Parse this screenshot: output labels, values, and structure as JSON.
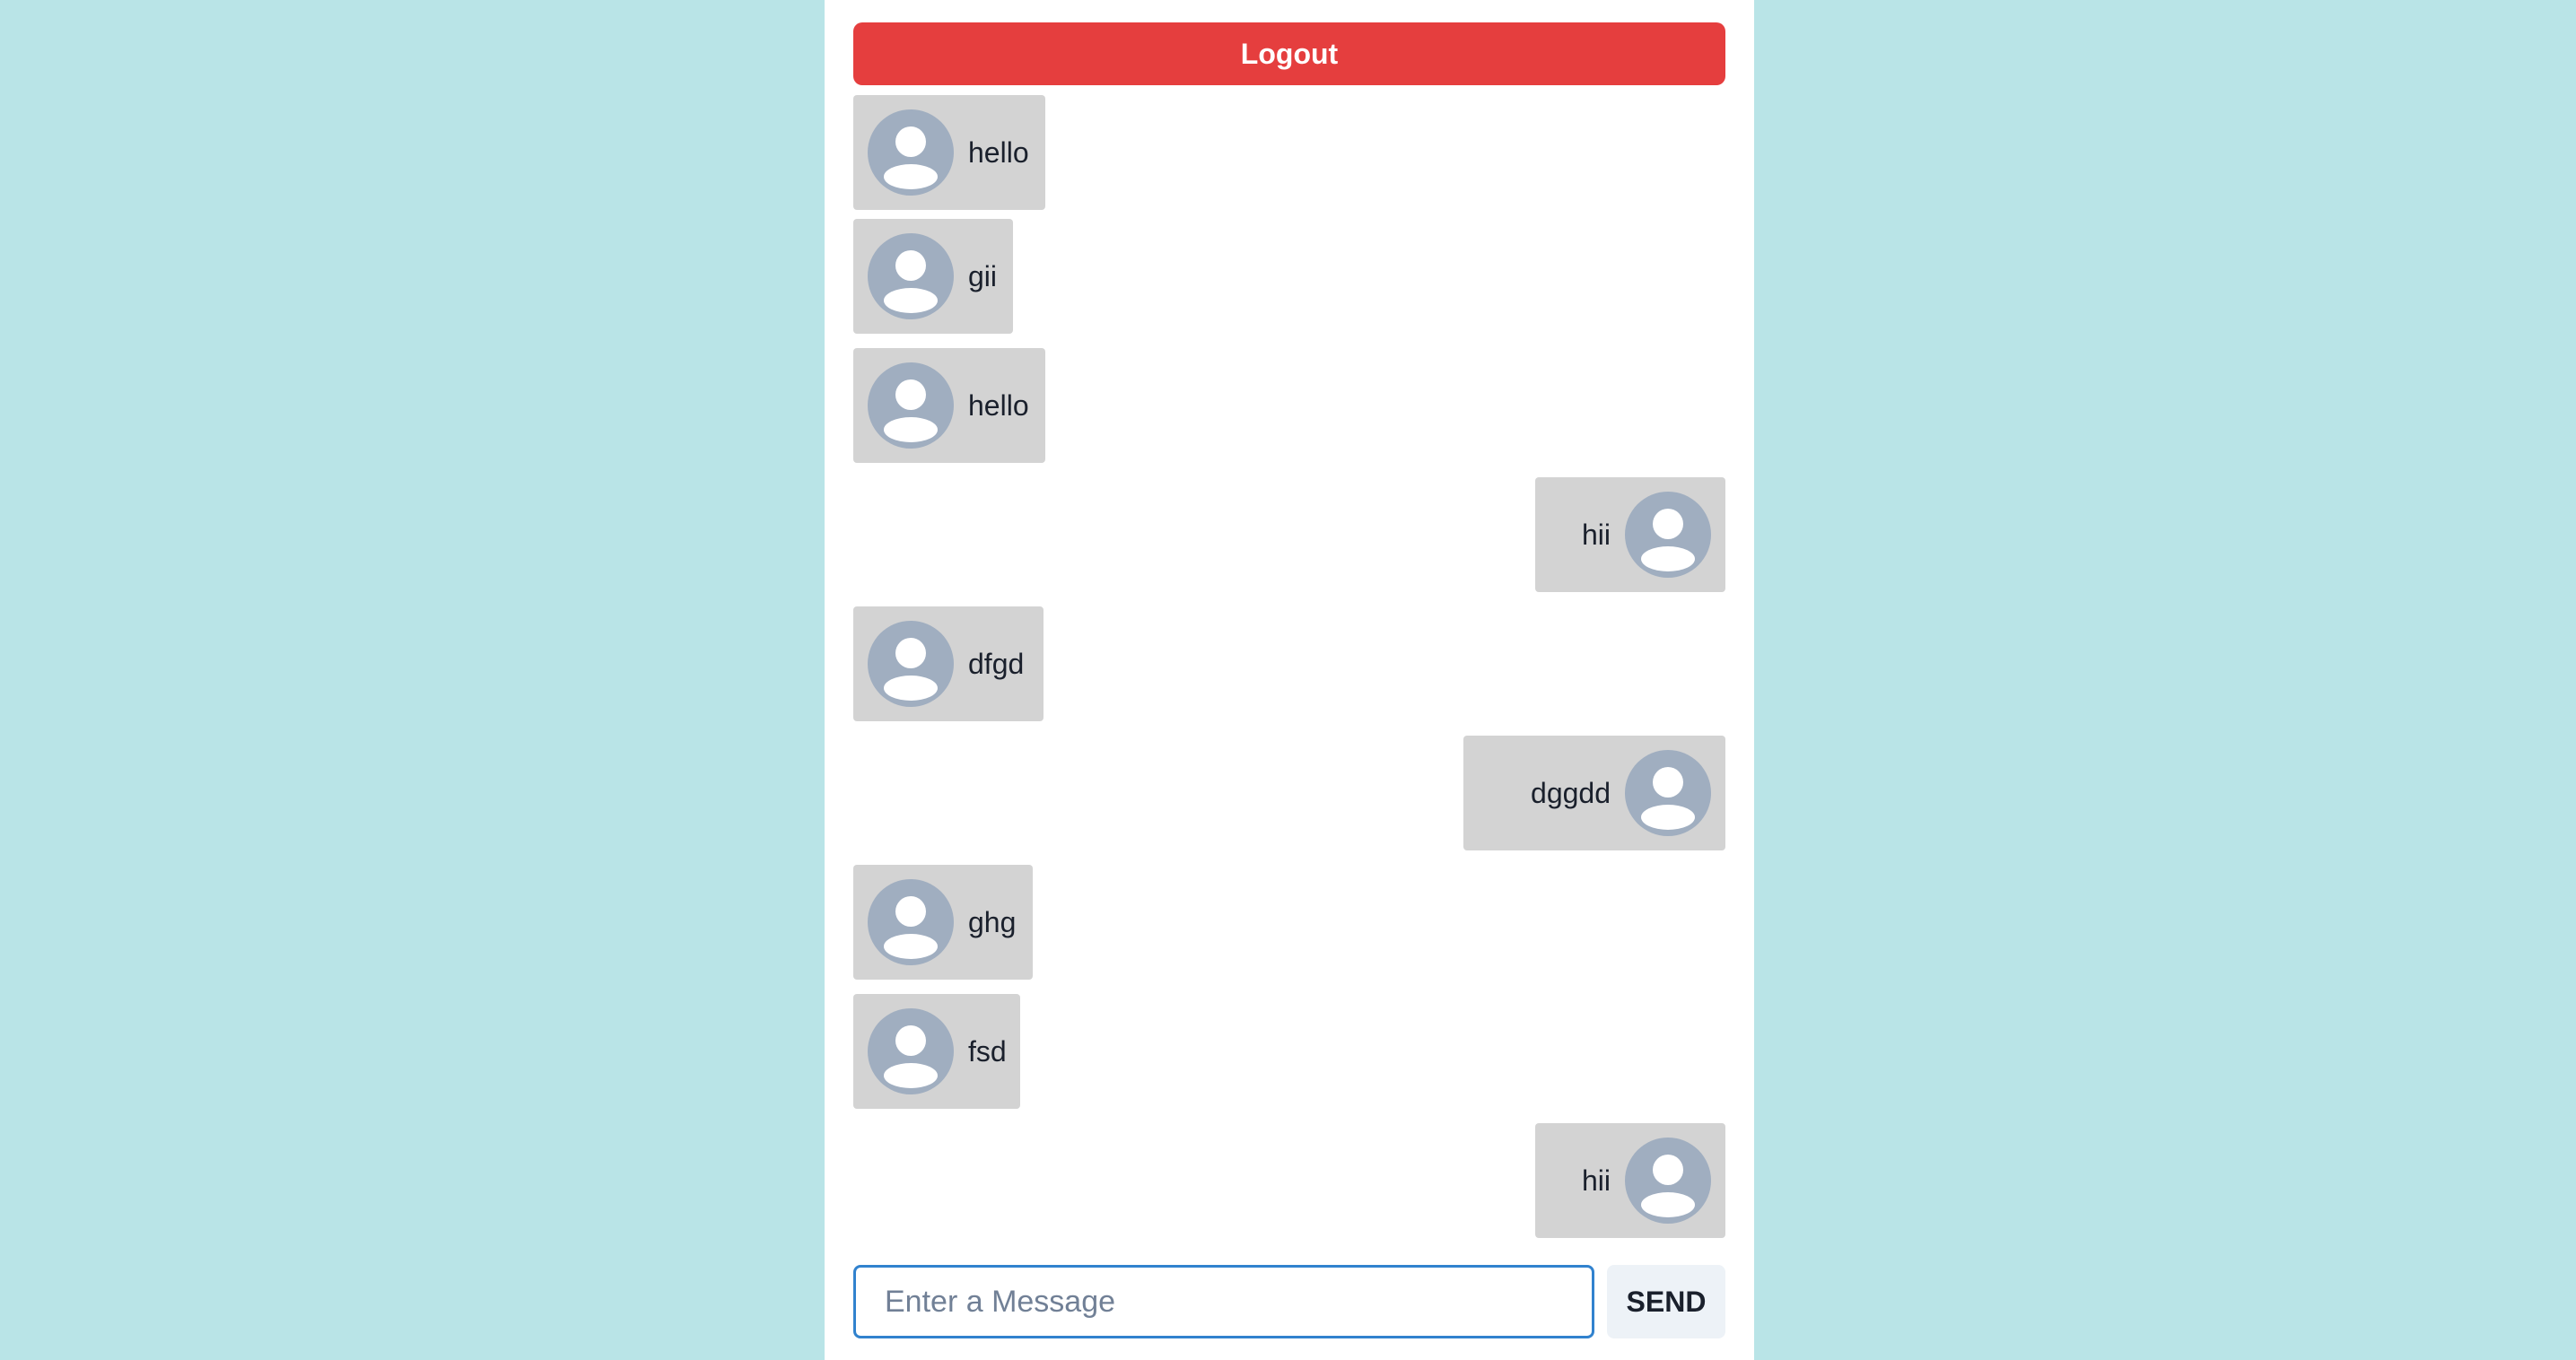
{
  "header": {
    "logout_label": "Logout"
  },
  "messages": [
    {
      "text": "hello",
      "side": "in"
    },
    {
      "text": "gii",
      "side": "in"
    },
    {
      "text": "hello",
      "side": "in"
    },
    {
      "text": "hii",
      "side": "out"
    },
    {
      "text": "dfgd",
      "side": "in"
    },
    {
      "text": "dggdd",
      "side": "out"
    },
    {
      "text": "ghg",
      "side": "in"
    },
    {
      "text": "fsd",
      "side": "in"
    },
    {
      "text": "hii",
      "side": "out"
    }
  ],
  "composer": {
    "placeholder": "Enter a Message",
    "value": "",
    "send_label": "SEND"
  },
  "icons": {
    "avatar": "user-avatar-icon"
  },
  "colors": {
    "background": "#b9e4e7",
    "logout": "#e53e3e",
    "bubble": "#d3d3d3",
    "avatar": "#a0aec0",
    "input_focus": "#3182ce",
    "send_button": "#edf2f7"
  }
}
